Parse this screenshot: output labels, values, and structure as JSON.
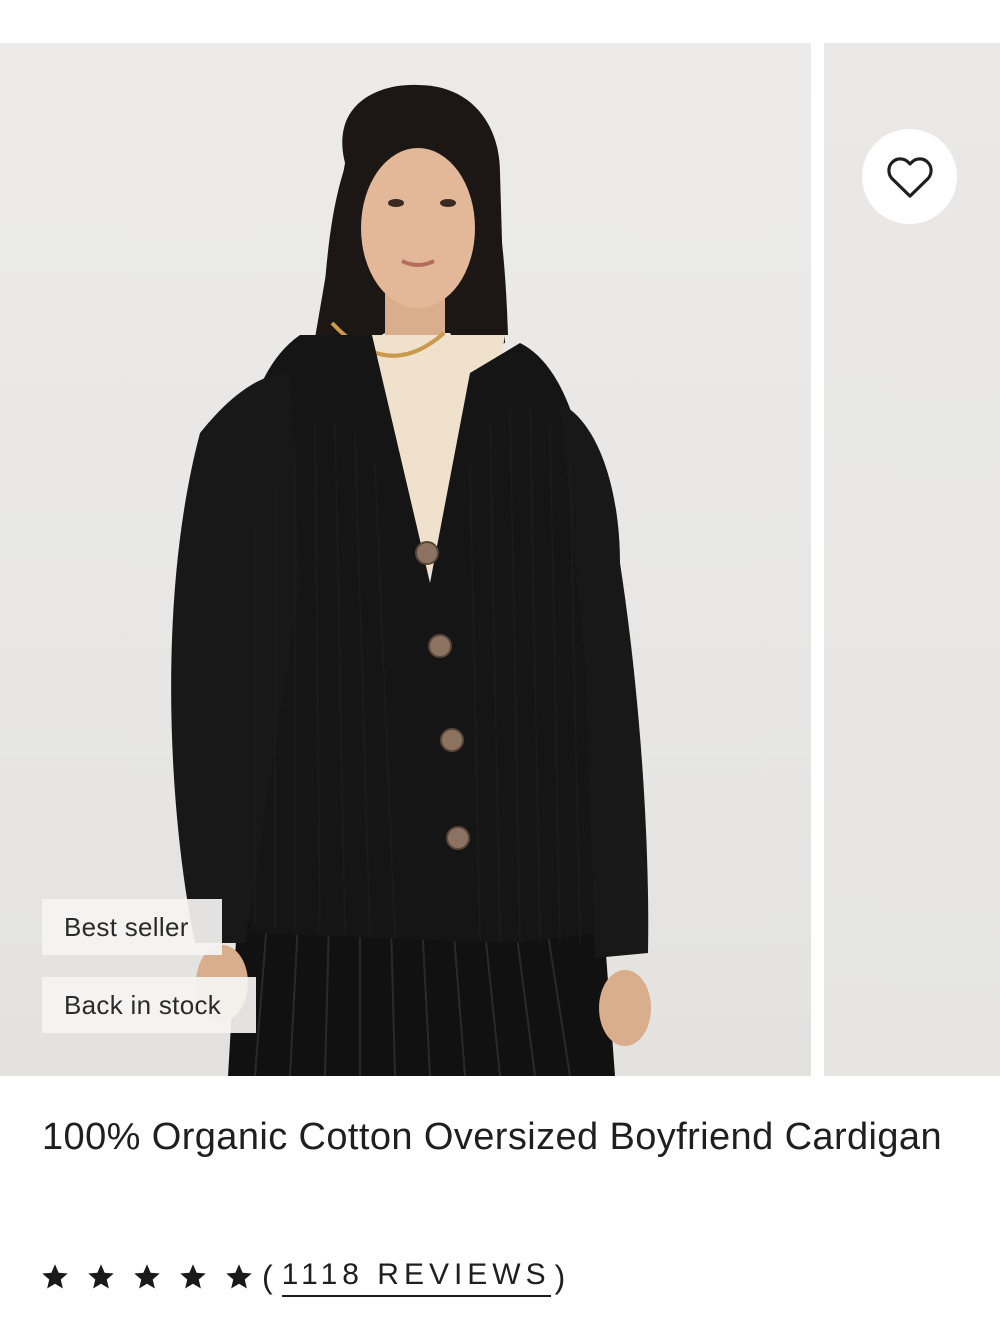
{
  "product": {
    "title": "100% Organic Cotton Oversized Boyfriend Cardigan",
    "badges": [
      "Best seller",
      "Back in stock"
    ],
    "rating": {
      "stars": 5,
      "open_paren": "(",
      "reviews_label": "1118 REVIEWS",
      "close_paren": ")"
    }
  },
  "icons": {
    "wishlist": "heart-outline-icon",
    "rating_star": "star-icon"
  },
  "colors": {
    "text": "#1f1f1f",
    "photo_background": "#e8e7e5",
    "cardigan": "#151515",
    "badge_background": "#f5f4f2"
  }
}
